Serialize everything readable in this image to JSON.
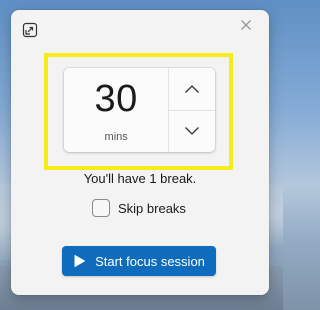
{
  "timer": {
    "value": "30",
    "unit": "mins"
  },
  "info": {
    "break_text": "You'll have 1 break."
  },
  "skip_breaks": {
    "label": "Skip breaks",
    "checked": false
  },
  "start_button": {
    "label": "Start focus session"
  },
  "icons": {
    "expand": "expand-window-icon",
    "close": "close-icon",
    "increment": "chevron-up-icon",
    "decrement": "chevron-down-icon",
    "play": "play-icon"
  },
  "colors": {
    "accent": "#0f6cbd",
    "highlight": "#f6ec1b",
    "card_background": "#f3f3f3"
  }
}
